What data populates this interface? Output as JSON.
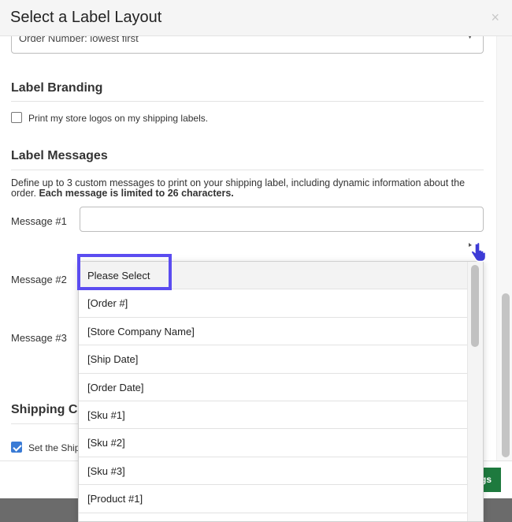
{
  "modal": {
    "title": "Select a Label Layout",
    "close_glyph": "×"
  },
  "sort_select": {
    "value": "Order Number: lowest first",
    "caret_glyph": "▼"
  },
  "branding": {
    "heading": "Label Branding",
    "logo_checkbox_label": "Print my store logos on my shipping labels.",
    "logo_checked": false
  },
  "messages": {
    "heading": "Label Messages",
    "description_plain": "Define up to 3 custom messages to print on your shipping label, including dynamic information about the order. ",
    "description_bold": "Each message is limited to 26 characters.",
    "label1": "Message #1",
    "label2": "Message #2",
    "label3": "Message #3",
    "value1": ""
  },
  "shipping": {
    "heading_visible": "Shipping Cu",
    "checkbox_label_visible": "Set the Ship",
    "checked": true
  },
  "footer": {
    "save_visible": "gs"
  },
  "dropdown": {
    "options": [
      "Please Select",
      "[Order #]",
      "[Store Company Name]",
      "[Ship Date]",
      "[Order Date]",
      "[Sku #1]",
      "[Sku #2]",
      "[Sku #3]",
      "[Product #1]"
    ]
  },
  "colors": {
    "highlight": "#5b4cf0",
    "checkbox_checked": "#3a7bd5",
    "save_button": "#1e7a3e"
  },
  "icons": {
    "cursor": "hand-pointer-icon"
  }
}
